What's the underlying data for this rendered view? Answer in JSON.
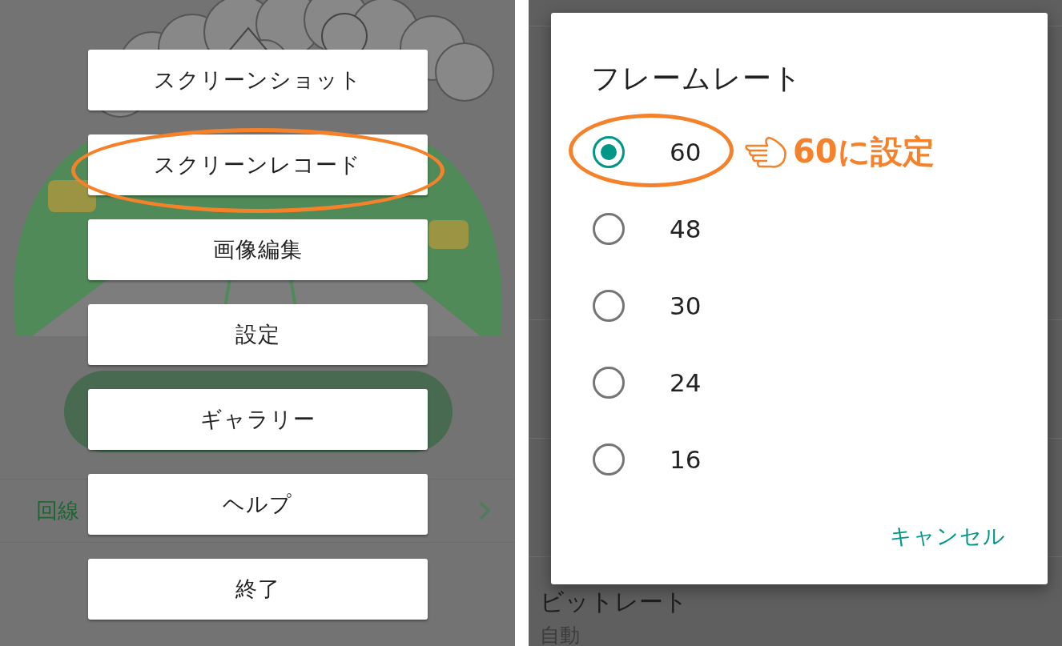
{
  "menu_screen": {
    "background": {
      "row_label": "回線"
    },
    "menu_items": [
      {
        "label": "スクリーンショット",
        "highlighted": false
      },
      {
        "label": "スクリーンレコード",
        "highlighted": true
      },
      {
        "label": "画像編集",
        "highlighted": false
      },
      {
        "label": "設定",
        "highlighted": false
      },
      {
        "label": "ギャラリー",
        "highlighted": false
      },
      {
        "label": "ヘルプ",
        "highlighted": false
      },
      {
        "label": "終了",
        "highlighted": false
      }
    ]
  },
  "settings_screen": {
    "background_items": [
      {
        "title": "ビットレート",
        "value": "自動"
      }
    ],
    "dialog": {
      "title": "フレームレート",
      "options": [
        {
          "label": "60",
          "selected": true,
          "annotated": true
        },
        {
          "label": "48",
          "selected": false,
          "annotated": false
        },
        {
          "label": "30",
          "selected": false,
          "annotated": false
        },
        {
          "label": "24",
          "selected": false,
          "annotated": false
        },
        {
          "label": "16",
          "selected": false,
          "annotated": false
        }
      ],
      "cancel": "キャンセル"
    }
  },
  "annotation": {
    "text": "60に設定"
  }
}
